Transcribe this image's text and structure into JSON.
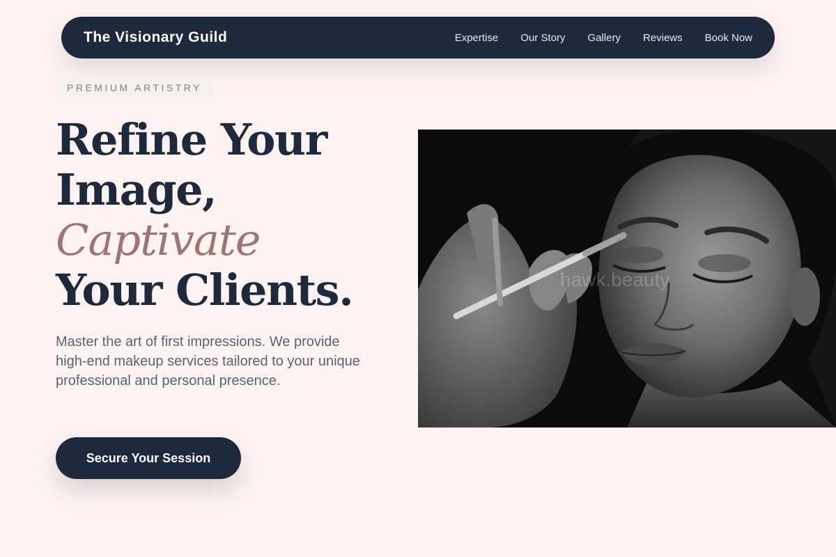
{
  "nav": {
    "brand": "The Visionary Guild",
    "links": [
      "Expertise",
      "Our Story",
      "Gallery",
      "Reviews",
      "Book Now"
    ]
  },
  "hero": {
    "badge": "PREMIUM ARTISTRY",
    "headline": {
      "line1": "Refine Your",
      "line2": "Image,",
      "accent": "Captivate",
      "line4": "Your Clients."
    },
    "subtext": "Master the art of first impressions. We provide high-end makeup services tailored to your unique professional and personal presence.",
    "cta_label": "Secure Your Session",
    "image_watermark": "hawk.beauty"
  },
  "colors": {
    "background": "#fdf3f2",
    "navy": "#1e293b",
    "accent_mauve": "#9d7573"
  },
  "icons": {
    "hero_image": "makeup-artist-photo"
  }
}
